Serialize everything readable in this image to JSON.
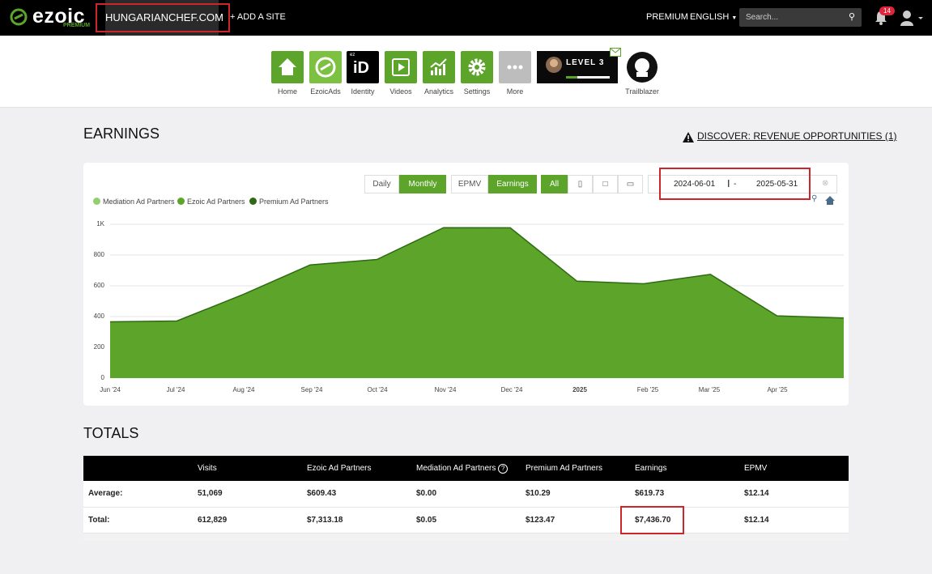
{
  "topbar": {
    "logo_text": "ezoic",
    "logo_tier": "PREMIUM",
    "site_name": "HUNGARIANCHEF.COM",
    "add_site": "+ ADD A SITE",
    "premium": "PREMIUM",
    "language": "ENGLISH",
    "search_placeholder": "Search...",
    "notification_count": "14"
  },
  "apps": [
    {
      "label": "Home",
      "icon": "home-icon"
    },
    {
      "label": "EzoicAds",
      "icon": "ezoicads-icon"
    },
    {
      "label": "Identity",
      "icon": "identity-icon"
    },
    {
      "label": "Videos",
      "icon": "videos-icon"
    },
    {
      "label": "Analytics",
      "icon": "analytics-icon"
    },
    {
      "label": "Settings",
      "icon": "gear-icon"
    },
    {
      "label": "More",
      "icon": "more-icon"
    },
    {
      "label": "Trailblazer",
      "icon": "trailblazer-icon"
    }
  ],
  "identity_badge": "iD",
  "identity_prefix": "ez",
  "level_label": "LEVEL 3",
  "earnings": {
    "title": "EARNINGS",
    "discover_link": "DISCOVER: REVENUE OPPORTUNITIES (1)",
    "toggles": {
      "daily": "Daily",
      "monthly": "Monthly",
      "epmv": "EPMV",
      "earnings": "Earnings",
      "all": "All"
    },
    "date_start": "2024-06-01",
    "date_sep": "-",
    "date_end": "2025-05-31"
  },
  "chart_data": {
    "type": "area",
    "series_legend": [
      "Mediation Ad Partners",
      "Ezoic Ad Partners",
      "Premium Ad Partners"
    ],
    "legend_colors": [
      "#93cf6f",
      "#5ca52a",
      "#2e6a14"
    ],
    "x_labels": [
      "Jun '24",
      "Jul '24",
      "Aug '24",
      "Sep '24",
      "Oct '24",
      "Nov '24",
      "Dec '24",
      "2025",
      "Feb '25",
      "Mar '25",
      "Apr '25"
    ],
    "y_ticks": [
      "1K",
      "800",
      "600",
      "400",
      "200",
      "0"
    ],
    "values": [
      366,
      371,
      544,
      736,
      771,
      978,
      977,
      630,
      613,
      674,
      405,
      390
    ],
    "ylim": [
      0,
      1000
    ],
    "fill_color": "#5ca52a",
    "line_color": "#2e6a14"
  },
  "totals": {
    "title": "TOTALS",
    "columns": [
      "",
      "Visits",
      "Ezoic Ad Partners",
      "Mediation Ad Partners",
      "Premium Ad Partners",
      "Earnings",
      "EPMV"
    ],
    "rows": [
      [
        "Average:",
        "51,069",
        "$609.43",
        "$0.00",
        "$10.29",
        "$619.73",
        "$12.14"
      ],
      [
        "Total:",
        "612,829",
        "$7,313.18",
        "$0.05",
        "$123.47",
        "$7,436.70",
        "$12.14"
      ]
    ]
  }
}
